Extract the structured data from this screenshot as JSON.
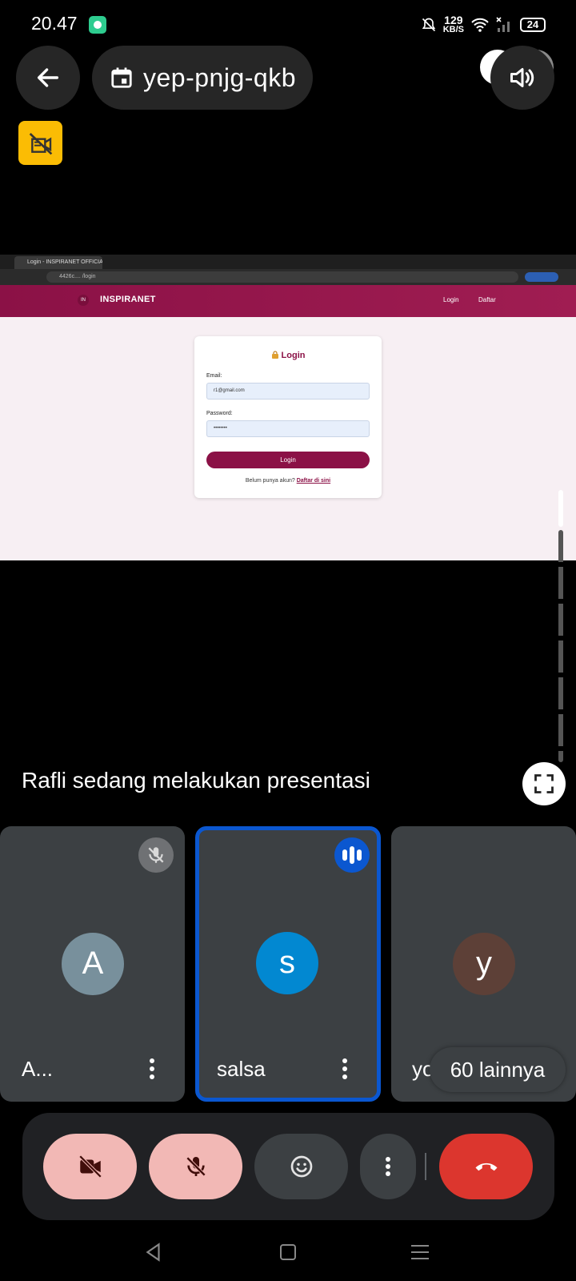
{
  "status_bar": {
    "time": "20.47",
    "speed_value": "129",
    "speed_unit": "KB/S",
    "battery": "24"
  },
  "meeting": {
    "code": "yep-pnjg-qkb"
  },
  "presentation": {
    "tab_title": "Login - INSPIRANET OFFICIAL",
    "url": "4426c.... /login",
    "brand": "INSPIRANET",
    "logo_text": "IN",
    "nav_login": "Login",
    "nav_daftar": "Daftar",
    "card_title": "Login",
    "email_label": "Email:",
    "email_value": "r1@gmail.com",
    "password_label": "Password:",
    "password_value": "••••••••",
    "login_button": "Login",
    "signup_text": "Belum punya akun? ",
    "signup_link": "Daftar di sini",
    "caption": "Rafli sedang melakukan presentasi"
  },
  "participants": [
    {
      "initial": "A",
      "name": "A...",
      "color": "#78909c",
      "muted": true
    },
    {
      "initial": "s",
      "name": "salsa",
      "color": "#0288d1",
      "speaking": true
    },
    {
      "initial": "y",
      "name": "yolanda",
      "color": "#5d4037"
    }
  ],
  "more_participants": "60 lainnya",
  "colors": {
    "accent": "#0b57d0",
    "off_control": "#f2b8b5",
    "hangup": "#dc362e",
    "no_video_badge": "#fbbc04",
    "site_brand": "#8b1146"
  },
  "icons": {
    "back": "arrow-left-icon",
    "calendar": "calendar-icon",
    "speaker": "speaker-icon",
    "no_video": "no-video-icon",
    "fullscreen": "fullscreen-icon",
    "camera_off": "camera-off-icon",
    "mic_off": "mic-off-icon",
    "emoji": "emoji-icon",
    "more": "more-vert-icon",
    "hangup": "phone-hangup-icon"
  }
}
